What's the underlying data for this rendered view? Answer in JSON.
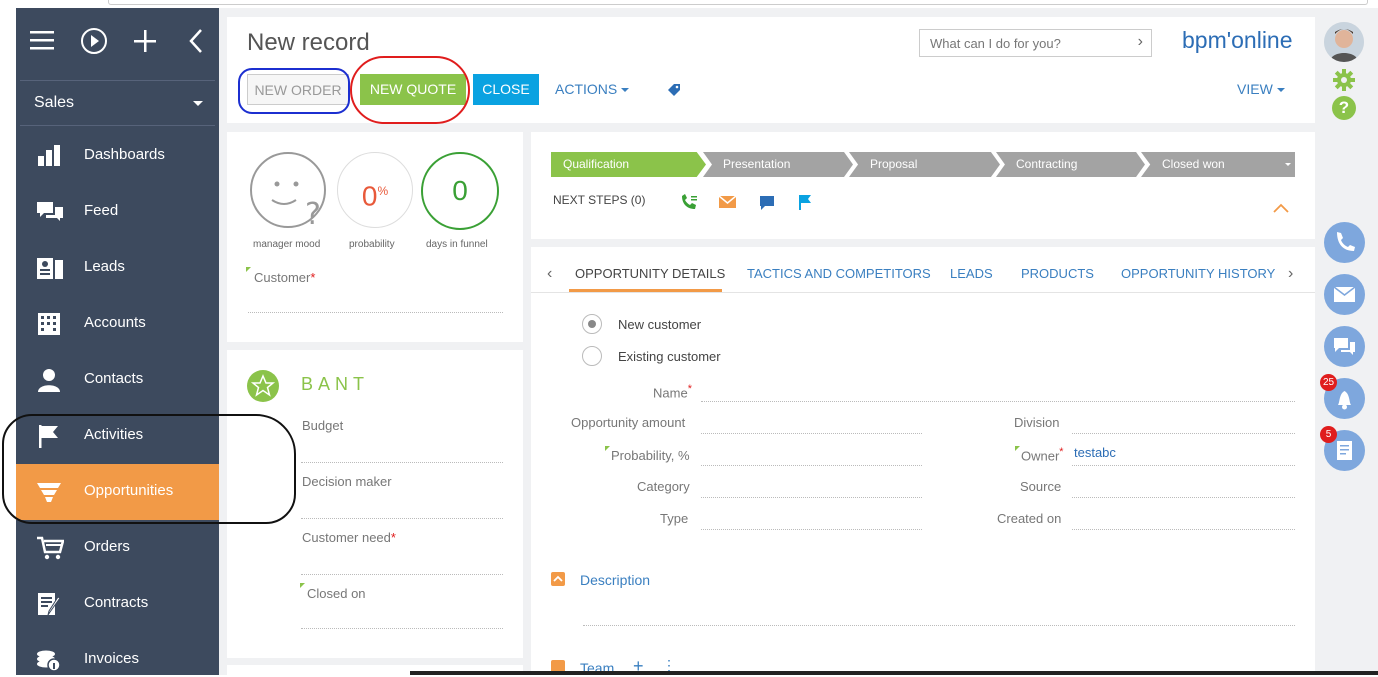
{
  "sidebar": {
    "section": "Sales",
    "items": [
      {
        "label": "Dashboards",
        "icon": "bar-chart-icon"
      },
      {
        "label": "Feed",
        "icon": "chat-bubbles-icon"
      },
      {
        "label": "Leads",
        "icon": "leads-icon"
      },
      {
        "label": "Accounts",
        "icon": "building-icon"
      },
      {
        "label": "Contacts",
        "icon": "person-icon"
      },
      {
        "label": "Activities",
        "icon": "flag-icon"
      },
      {
        "label": "Opportunities",
        "icon": "funnel-icon"
      },
      {
        "label": "Orders",
        "icon": "cart-icon"
      },
      {
        "label": "Contracts",
        "icon": "contract-icon"
      },
      {
        "label": "Invoices",
        "icon": "invoice-icon"
      }
    ]
  },
  "header": {
    "title": "New record",
    "search_placeholder": "What can I do for you?",
    "brand": "bpm'online",
    "buttons": {
      "new_order": "NEW ORDER",
      "new_quote": "NEW QUOTE",
      "close": "CLOSE",
      "actions": "ACTIONS",
      "view": "VIEW"
    }
  },
  "indicators": {
    "mood_label": "manager mood",
    "probability_value": "0",
    "probability_unit": "%",
    "probability_label": "probability",
    "days_value": "0",
    "days_label": "days in funnel"
  },
  "left_form": {
    "customer": "Customer"
  },
  "bant": {
    "title": "BANT",
    "budget": "Budget",
    "decision_maker": "Decision maker",
    "customer_need": "Customer need",
    "closed_on": "Closed on"
  },
  "stages": [
    "Qualification",
    "Presentation",
    "Proposal",
    "Contracting",
    "Closed won"
  ],
  "next_steps": "NEXT STEPS (0)",
  "tabs": [
    "OPPORTUNITY DETAILS",
    "TACTICS AND COMPETITORS",
    "LEADS",
    "PRODUCTS",
    "OPPORTUNITY HISTORY"
  ],
  "details": {
    "new_customer": "New customer",
    "existing_customer": "Existing customer",
    "name": "Name",
    "opportunity_amount": "Opportunity amount",
    "probability": "Probability, %",
    "category": "Category",
    "type": "Type",
    "division": "Division",
    "owner": "Owner",
    "owner_value": "testabc",
    "source": "Source",
    "created_on": "Created on",
    "description": "Description",
    "team": "Team"
  },
  "badges": {
    "notifications": "25",
    "tasks": "5"
  },
  "colors": {
    "sidebar": "#3d4a5e",
    "active": "#f29a47",
    "green": "#8bc34a",
    "blue": "#0aa2e1"
  }
}
